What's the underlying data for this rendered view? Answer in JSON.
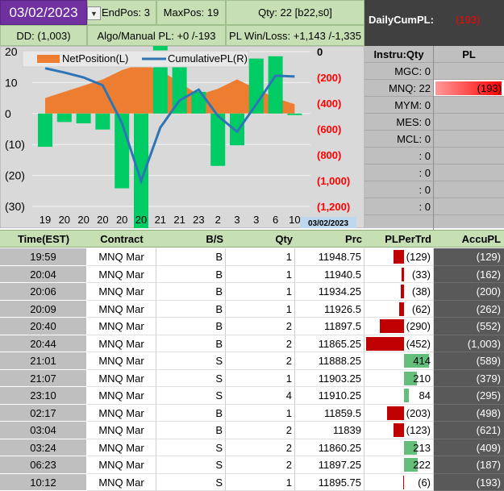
{
  "header": {
    "date": "03/02/2023",
    "end_pos": "EndPos: 3",
    "max_pos": "MaxPos: 19",
    "qty": "Qty: 22 [b22,s0]",
    "dd": "DD: (1,003)",
    "algo_manual_pl": "Algo/Manual PL: +0 /-193",
    "pl_win_loss": "PL Win/Loss: +1,143 /-1,335",
    "daily_cum_pl_label": "DailyCumPL:",
    "daily_cum_pl_value": "(193)"
  },
  "colors": {
    "purple": "#7030a0",
    "green_cell": "#c6e0b4",
    "net_position": "#ed7d31",
    "cumulative_pl": "#2e75b6",
    "pl_bar_pos": "#00cc66",
    "loss_red": "#c00000"
  },
  "chart_data": {
    "type": "bar",
    "legend": [
      "NetPosition(L)",
      "CumulativePL(R)"
    ],
    "legend_position": "top-left",
    "categories": [
      "19",
      "20",
      "20",
      "20",
      "20",
      "20",
      "21",
      "21",
      "23",
      "2",
      "3",
      "3",
      "6",
      "10"
    ],
    "date_label": "03/02/2023",
    "left_axis": {
      "ticks": [
        "20",
        "10",
        "0",
        "(10)",
        "(20)",
        "(30)"
      ],
      "min": -30,
      "max": 20
    },
    "right_axis": {
      "ticks": [
        "0",
        "(200)",
        "(400)",
        "(600)",
        "(800)",
        "(1,000)",
        "(1,200)"
      ],
      "min": -1200,
      "max": 0
    },
    "series": [
      {
        "name": "NetPosition(L)",
        "kind": "area",
        "values": [
          5,
          7,
          9,
          11,
          14,
          16,
          14,
          10,
          6,
          8,
          11,
          8,
          5,
          3
        ]
      },
      {
        "name": "CumulativePL(R)",
        "kind": "line",
        "values": [
          -129,
          -162,
          -200,
          -262,
          -552,
          -1003,
          -589,
          -379,
          -295,
          -498,
          -621,
          -409,
          -187,
          -193
        ]
      },
      {
        "name": "PLPerTrd",
        "kind": "bar",
        "values": [
          -129,
          -33,
          -38,
          -62,
          -290,
          -452,
          414,
          210,
          84,
          -203,
          -123,
          213,
          222,
          -6
        ]
      }
    ]
  },
  "instruments": {
    "header_name": "Instru:Qty",
    "header_pl": "PL",
    "rows": [
      {
        "name": "MGC: 0",
        "pl": ""
      },
      {
        "name": "MNQ: 22",
        "pl": "(193)",
        "pl_fraction": 1.0
      },
      {
        "name": "MYM: 0",
        "pl": ""
      },
      {
        "name": "MES: 0",
        "pl": ""
      },
      {
        "name": "MCL: 0",
        "pl": ""
      },
      {
        "name": ": 0",
        "pl": ""
      },
      {
        "name": ": 0",
        "pl": ""
      },
      {
        "name": ": 0",
        "pl": ""
      },
      {
        "name": ": 0",
        "pl": ""
      },
      {
        "name": "",
        "pl": ""
      }
    ]
  },
  "trades": {
    "columns": [
      "Time(EST)",
      "Contract",
      "B/S",
      "Qty",
      "Prc",
      "PLPerTrd",
      "AccuPL"
    ],
    "rows": [
      {
        "time": "19:59",
        "contract": "MNQ Mar",
        "side": "B",
        "qty": "1",
        "prc": "11948.75",
        "pl": "(129)",
        "pl_value": -129,
        "accu": "(129)"
      },
      {
        "time": "20:04",
        "contract": "MNQ Mar",
        "side": "B",
        "qty": "1",
        "prc": "11940.5",
        "pl": "(33)",
        "pl_value": -33,
        "accu": "(162)"
      },
      {
        "time": "20:06",
        "contract": "MNQ Mar",
        "side": "B",
        "qty": "1",
        "prc": "11934.25",
        "pl": "(38)",
        "pl_value": -38,
        "accu": "(200)"
      },
      {
        "time": "20:09",
        "contract": "MNQ Mar",
        "side": "B",
        "qty": "1",
        "prc": "11926.5",
        "pl": "(62)",
        "pl_value": -62,
        "accu": "(262)"
      },
      {
        "time": "20:40",
        "contract": "MNQ Mar",
        "side": "B",
        "qty": "2",
        "prc": "11897.5",
        "pl": "(290)",
        "pl_value": -290,
        "accu": "(552)"
      },
      {
        "time": "20:44",
        "contract": "MNQ Mar",
        "side": "B",
        "qty": "2",
        "prc": "11865.25",
        "pl": "(452)",
        "pl_value": -452,
        "accu": "(1,003)"
      },
      {
        "time": "21:01",
        "contract": "MNQ Mar",
        "side": "S",
        "qty": "2",
        "prc": "11888.25",
        "pl": "414",
        "pl_value": 414,
        "accu": "(589)"
      },
      {
        "time": "21:07",
        "contract": "MNQ Mar",
        "side": "S",
        "qty": "1",
        "prc": "11903.25",
        "pl": "210",
        "pl_value": 210,
        "accu": "(379)"
      },
      {
        "time": "23:10",
        "contract": "MNQ Mar",
        "side": "S",
        "qty": "4",
        "prc": "11910.25",
        "pl": "84",
        "pl_value": 84,
        "accu": "(295)"
      },
      {
        "time": "02:17",
        "contract": "MNQ Mar",
        "side": "B",
        "qty": "1",
        "prc": "11859.5",
        "pl": "(203)",
        "pl_value": -203,
        "accu": "(498)"
      },
      {
        "time": "03:04",
        "contract": "MNQ Mar",
        "side": "B",
        "qty": "2",
        "prc": "11839",
        "pl": "(123)",
        "pl_value": -123,
        "accu": "(621)"
      },
      {
        "time": "03:24",
        "contract": "MNQ Mar",
        "side": "S",
        "qty": "2",
        "prc": "11860.25",
        "pl": "213",
        "pl_value": 213,
        "accu": "(409)"
      },
      {
        "time": "06:23",
        "contract": "MNQ Mar",
        "side": "S",
        "qty": "2",
        "prc": "11897.25",
        "pl": "222",
        "pl_value": 222,
        "accu": "(187)"
      },
      {
        "time": "10:12",
        "contract": "MNQ Mar",
        "side": "S",
        "qty": "1",
        "prc": "11895.75",
        "pl": "(6)",
        "pl_value": -6,
        "accu": "(193)"
      }
    ]
  }
}
